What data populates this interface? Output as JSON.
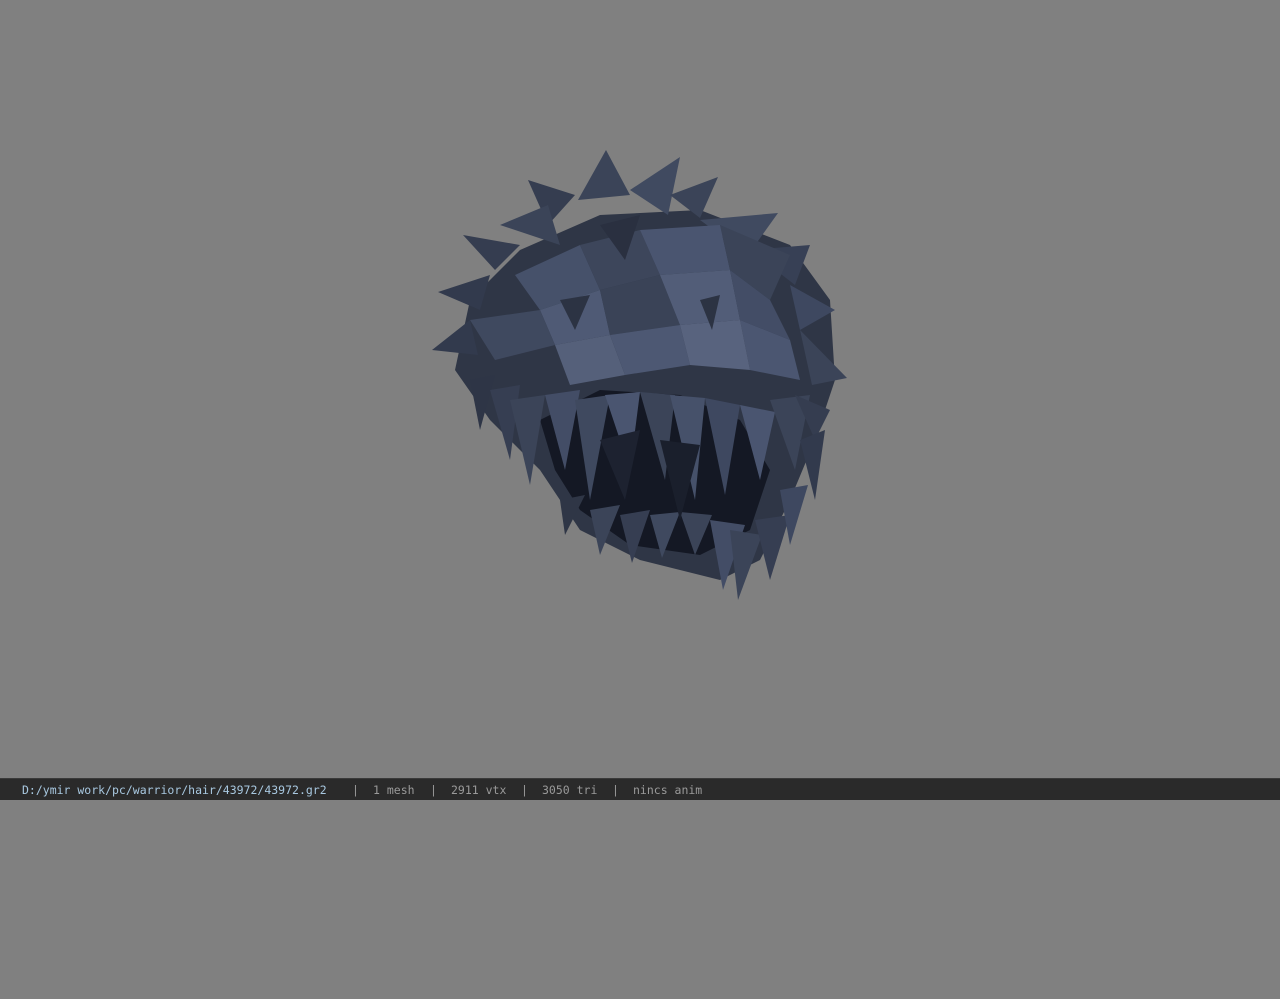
{
  "viewer": {
    "background_color": "#808080",
    "model_color": "#3b4458",
    "model_shadow_color": "#141824",
    "model_highlight_color": "#55607a"
  },
  "status_bar": {
    "file_path": "D:/ymir work/pc/warrior/hair/43972/43972.gr2",
    "separator": "|",
    "mesh_count": "1 mesh",
    "vertex_count": "2911 vtx",
    "triangle_count": "3050 tri",
    "animation": "nincs anim"
  }
}
